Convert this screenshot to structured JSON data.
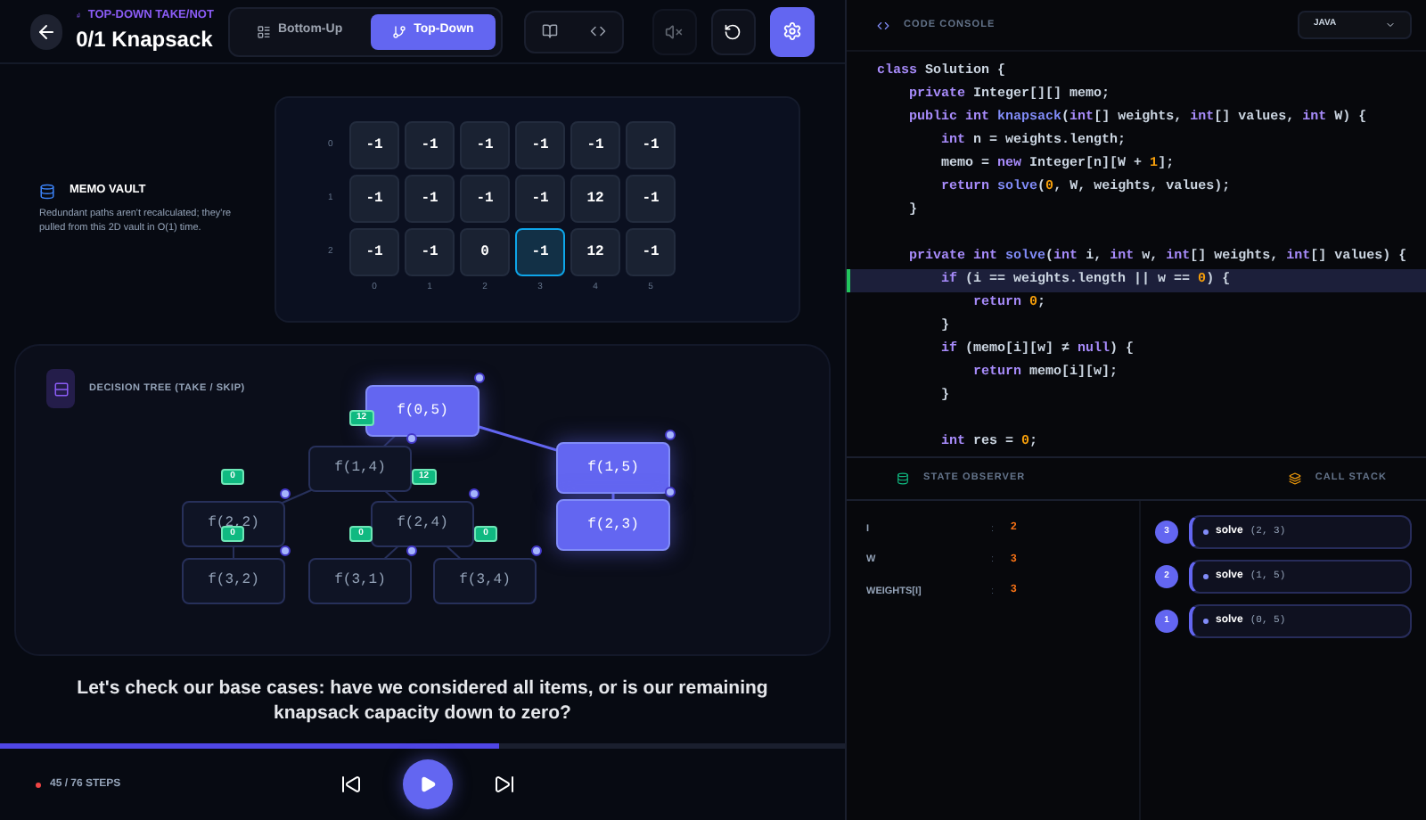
{
  "header": {
    "subtitle": "TOP-DOWN TAKE/NOT",
    "title": "0/1 Knapsack",
    "modes": [
      {
        "label": "Bottom-Up",
        "selected": false
      },
      {
        "label": "Top-Down",
        "selected": true
      }
    ],
    "muted": true
  },
  "memo": {
    "title": "MEMO VAULT",
    "description": "Redundant paths aren't recalculated; they're pulled from this 2D vault in O(1) time.",
    "row_labels": [
      "0",
      "1",
      "2"
    ],
    "col_labels": [
      "0",
      "1",
      "2",
      "3",
      "4",
      "5"
    ],
    "rows": [
      [
        {
          "value": "-1",
          "selected": false
        },
        {
          "value": "-1",
          "selected": false
        },
        {
          "value": "-1",
          "selected": false
        },
        {
          "value": "-1",
          "selected": false
        },
        {
          "value": "-1",
          "selected": false
        },
        {
          "value": "-1",
          "selected": false
        }
      ],
      [
        {
          "value": "-1",
          "selected": false
        },
        {
          "value": "-1",
          "selected": false
        },
        {
          "value": "-1",
          "selected": false
        },
        {
          "value": "-1",
          "selected": false
        },
        {
          "value": "12",
          "selected": false
        },
        {
          "value": "-1",
          "selected": false
        }
      ],
      [
        {
          "value": "-1",
          "selected": false
        },
        {
          "value": "-1",
          "selected": false
        },
        {
          "value": "0",
          "selected": false
        },
        {
          "value": "-1",
          "selected": true
        },
        {
          "value": "12",
          "selected": false
        },
        {
          "value": "-1",
          "selected": false
        }
      ]
    ]
  },
  "tree": {
    "title": "DECISION TREE (TAKE / SKIP)",
    "nodes": [
      {
        "label": "f(0,5)",
        "active": true
      },
      {
        "label": "f(1,4)",
        "active": false
      },
      {
        "label": "f(1,5)",
        "active": true
      },
      {
        "label": "f(2,2)",
        "active": false
      },
      {
        "label": "f(2,4)",
        "active": false
      },
      {
        "label": "f(2,3)",
        "active": true
      },
      {
        "label": "f(3,2)",
        "active": false
      },
      {
        "label": "f(3,1)",
        "active": false
      },
      {
        "label": "f(3,4)",
        "active": false
      }
    ],
    "badges": [
      "12",
      "0",
      "12",
      "0",
      "0",
      "0"
    ]
  },
  "narration": "Let's check our base cases: have we considered all items, or is our remaining knapsack capacity down to zero?",
  "progress": {
    "level": 0.59,
    "steps": "45 / 76 STEPS"
  },
  "console": {
    "title": "CODE CONSOLE",
    "language": "JAVA",
    "lines": [
      {
        "current": false,
        "tokens": [
          {
            "kind": "kw",
            "text": "class"
          },
          {
            "kind": "plain",
            "text": " Solution {"
          }
        ]
      },
      {
        "current": false,
        "tokens": [
          {
            "kind": "kw",
            "text": "    private"
          },
          {
            "kind": "plain",
            "text": " Integer[][] memo;"
          }
        ]
      },
      {
        "current": false,
        "tokens": [
          {
            "kind": "kw",
            "text": "    public int"
          },
          {
            "kind": "fn",
            "text": " knapsack"
          },
          {
            "kind": "plain",
            "text": "("
          },
          {
            "kind": "kw",
            "text": "int"
          },
          {
            "kind": "plain",
            "text": "[] weights, "
          },
          {
            "kind": "kw",
            "text": "int"
          },
          {
            "kind": "plain",
            "text": "[] values, "
          },
          {
            "kind": "kw",
            "text": "int"
          },
          {
            "kind": "plain",
            "text": " W) {"
          }
        ]
      },
      {
        "current": false,
        "tokens": [
          {
            "kind": "kw",
            "text": "        int"
          },
          {
            "kind": "plain",
            "text": " n = weights.length;"
          }
        ]
      },
      {
        "current": false,
        "tokens": [
          {
            "kind": "plain",
            "text": "        memo = "
          },
          {
            "kind": "kw",
            "text": "new"
          },
          {
            "kind": "plain",
            "text": " Integer[n][W + "
          },
          {
            "kind": "num",
            "text": "1"
          },
          {
            "kind": "plain",
            "text": "];"
          }
        ]
      },
      {
        "current": false,
        "tokens": [
          {
            "kind": "kw",
            "text": "        return"
          },
          {
            "kind": "fn",
            "text": " solve"
          },
          {
            "kind": "plain",
            "text": "("
          },
          {
            "kind": "num",
            "text": "0"
          },
          {
            "kind": "plain",
            "text": ", W, weights, values);"
          }
        ]
      },
      {
        "current": false,
        "tokens": [
          {
            "kind": "plain",
            "text": "    }"
          }
        ]
      },
      {
        "current": false
      },
      {
        "current": false,
        "tokens": [
          {
            "kind": "kw",
            "text": "    private int"
          },
          {
            "kind": "fn",
            "text": " solve"
          },
          {
            "kind": "plain",
            "text": "("
          },
          {
            "kind": "kw",
            "text": "int"
          },
          {
            "kind": "plain",
            "text": " i, "
          },
          {
            "kind": "kw",
            "text": "int"
          },
          {
            "kind": "plain",
            "text": " w, "
          },
          {
            "kind": "kw",
            "text": "int"
          },
          {
            "kind": "plain",
            "text": "[] weights, "
          },
          {
            "kind": "kw",
            "text": "int"
          },
          {
            "kind": "plain",
            "text": "[] values) {"
          }
        ]
      },
      {
        "current": true,
        "tokens": [
          {
            "kind": "kw",
            "text": "        if"
          },
          {
            "kind": "plain",
            "text": " (i == weights.length || w == "
          },
          {
            "kind": "num",
            "text": "0"
          },
          {
            "kind": "plain",
            "text": ") {"
          }
        ]
      },
      {
        "current": false,
        "tokens": [
          {
            "kind": "kw",
            "text": "            return"
          },
          {
            "kind": "num",
            "text": " 0"
          },
          {
            "kind": "plain",
            "text": ";"
          }
        ]
      },
      {
        "current": false,
        "tokens": [
          {
            "kind": "plain",
            "text": "        }"
          }
        ]
      },
      {
        "current": false,
        "tokens": [
          {
            "kind": "kw",
            "text": "        if"
          },
          {
            "kind": "plain",
            "text": " (memo[i][w] ≠ "
          },
          {
            "kind": "kw",
            "text": "null"
          },
          {
            "kind": "plain",
            "text": ") {"
          }
        ]
      },
      {
        "current": false,
        "tokens": [
          {
            "kind": "kw",
            "text": "            return"
          },
          {
            "kind": "plain",
            "text": " memo[i][w];"
          }
        ]
      },
      {
        "current": false,
        "tokens": [
          {
            "kind": "plain",
            "text": "        }"
          }
        ]
      },
      {
        "current": false
      },
      {
        "current": false,
        "tokens": [
          {
            "kind": "kw",
            "text": "        int"
          },
          {
            "kind": "plain",
            "text": " res = "
          },
          {
            "kind": "num",
            "text": "0"
          },
          {
            "kind": "plain",
            "text": ";"
          }
        ]
      }
    ]
  },
  "state_observer": {
    "title": "STATE OBSERVER",
    "variables": [
      {
        "name": "I",
        "separator": ":",
        "value": "2"
      },
      {
        "name": "W",
        "separator": ":",
        "value": "3"
      },
      {
        "name": "WEIGHTS[I]",
        "separator": ":",
        "value": "3"
      }
    ]
  },
  "call_stack": {
    "title": "CALL STACK",
    "frames": [
      {
        "depth": "3",
        "name": "solve",
        "args": "(2, 3)"
      },
      {
        "depth": "2",
        "name": "solve",
        "args": "(1, 5)"
      },
      {
        "depth": "1",
        "name": "solve",
        "args": "(0, 5)"
      }
    ]
  }
}
